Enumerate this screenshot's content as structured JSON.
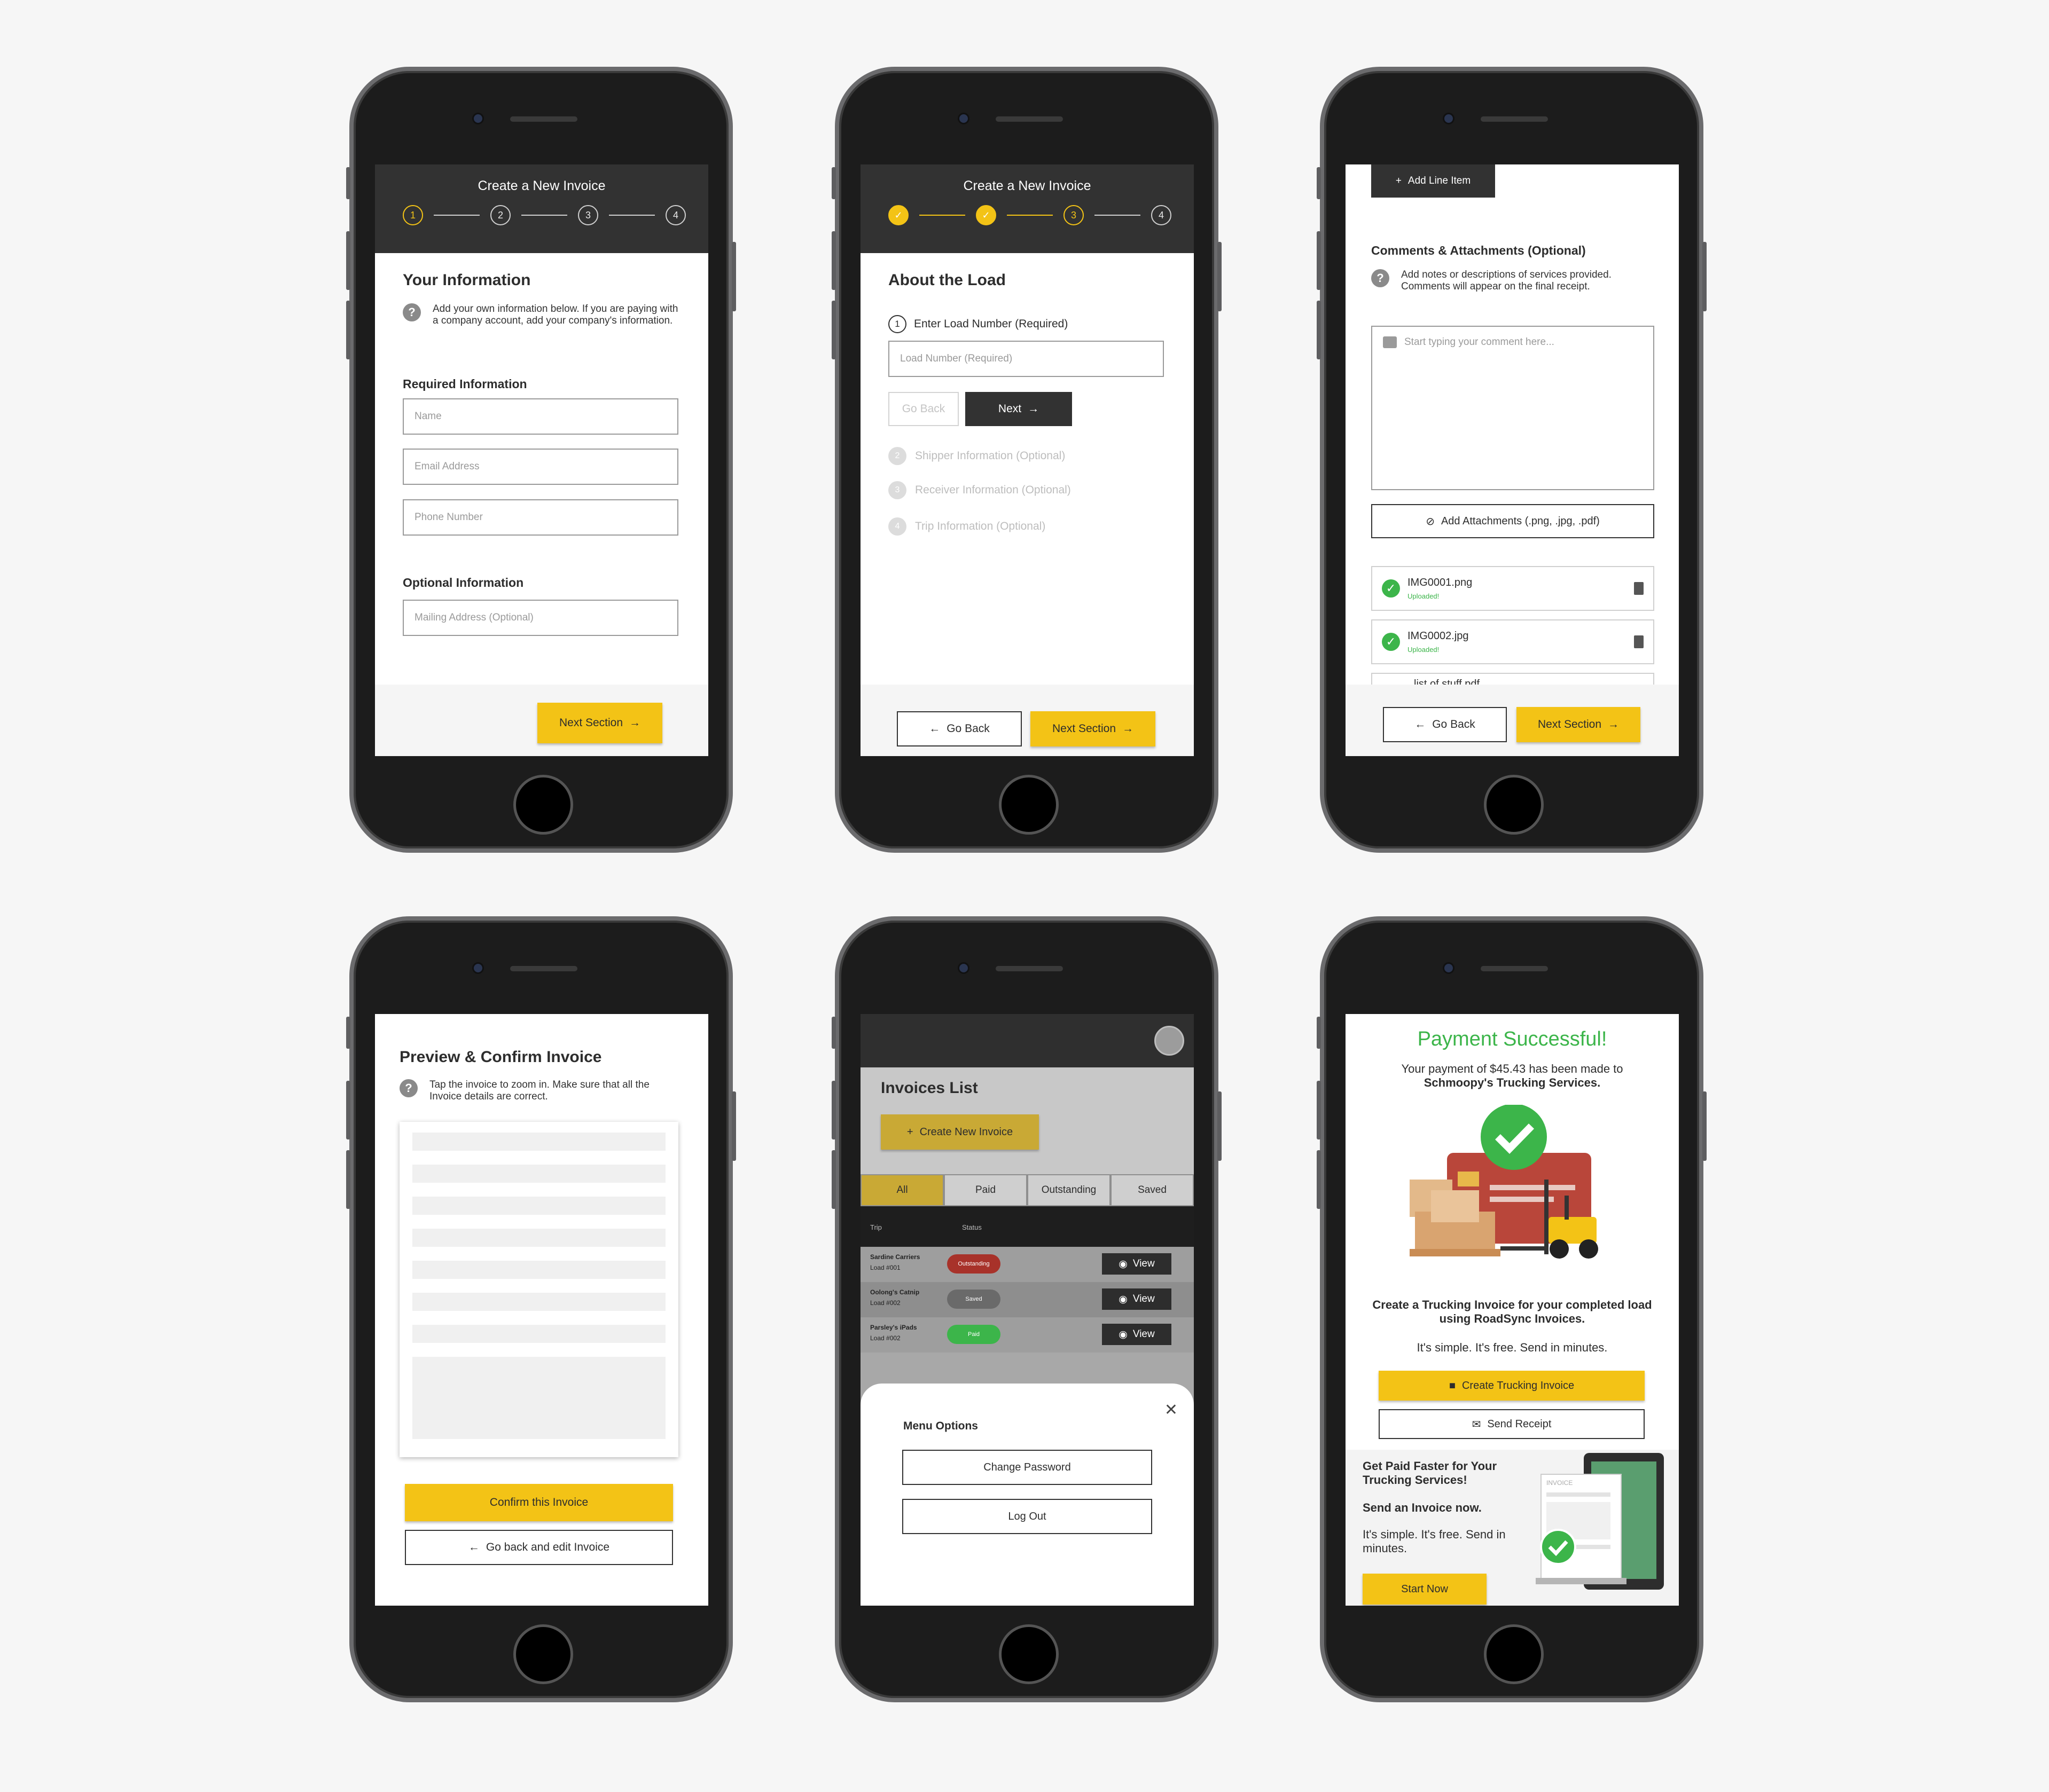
{
  "colors": {
    "accent": "#f3c316",
    "dark": "#323232",
    "success": "#3cb54a",
    "danger": "#c0392b"
  },
  "screen1": {
    "header_title": "Create a New Invoice",
    "steps": [
      "1",
      "2",
      "3",
      "4"
    ],
    "title": "Your Information",
    "help": "Add your own information below. If you are paying with a company account, add your company's information.",
    "required_label": "Required Information",
    "name_placeholder": "Name",
    "email_placeholder": "Email Address",
    "phone_placeholder": "Phone Number",
    "optional_label": "Optional Information",
    "mailing_placeholder": "Mailing Address (Optional)",
    "next_button": "Next Section"
  },
  "screen2": {
    "header_title": "Create a New Invoice",
    "steps": [
      "3",
      "4"
    ],
    "title": "About the Load",
    "step1_num": "1",
    "step1_label": "Enter Load Number (Required)",
    "load_placeholder": "Load Number (Required)",
    "goback_small": "Go Back",
    "next_small": "Next",
    "substeps": [
      {
        "num": "2",
        "label": "Shipper Information (Optional)"
      },
      {
        "num": "3",
        "label": "Receiver Information (Optional)"
      },
      {
        "num": "4",
        "label": "Trip Information (Optional)"
      }
    ],
    "goback_button": "Go Back",
    "next_button": "Next Section"
  },
  "screen3": {
    "add_line_item": "Add Line Item",
    "title": "Comments & Attachments (Optional)",
    "help": "Add notes or descriptions of services provided. Comments will appear on the final receipt.",
    "comment_placeholder": "Start typing your comment here...",
    "add_attachments": "Add Attachments (.png, .jpg, .pdf)",
    "files": [
      {
        "name": "IMG0001.png",
        "status": "Uploaded!"
      },
      {
        "name": "IMG0002.jpg",
        "status": "Uploaded!"
      }
    ],
    "partial_file": "list of stuff.pdf",
    "goback_button": "Go Back",
    "next_button": "Next Section"
  },
  "screen4": {
    "title": "Preview & Confirm Invoice",
    "help": "Tap the invoice to zoom in. Make sure that all the Invoice details are correct.",
    "confirm_button": "Confirm this Invoice",
    "goback_button": "Go back and edit Invoice"
  },
  "screen5": {
    "title": "Invoices List",
    "create_button": "Create New Invoice",
    "tabs": [
      "All",
      "Paid",
      "Outstanding",
      "Saved"
    ],
    "col_trip": "Trip",
    "col_status": "Status",
    "rows": [
      {
        "trip": "Sardine Carriers",
        "load": "Load #001",
        "status": "Outstanding",
        "view": "View"
      },
      {
        "trip": "Oolong's Catnip",
        "load": "Load #002",
        "status": "Saved",
        "view": "View"
      },
      {
        "trip": "Parsley's iPads",
        "load": "Load #002",
        "status": "Paid",
        "view": "View"
      }
    ],
    "menu_title": "Menu Options",
    "change_password": "Change Password",
    "log_out": "Log Out"
  },
  "screen6": {
    "title": "Payment Successful!",
    "message_line1": "Your payment of $45.43 has been made to",
    "message_line2": "Schmoopy's Trucking Services.",
    "promo_bold": "Create a Trucking Invoice for your completed load using RoadSync Invoices.",
    "promo_sub": "It's simple. It's free. Send in minutes.",
    "create_button": "Create Trucking Invoice",
    "receipt_button": "Send Receipt",
    "card_title": "Get Paid Faster for Your Trucking Services!",
    "card_sub": "Send an Invoice now.",
    "card_text": "It's simple. It's free. Send in minutes.",
    "invoice_word": "INVOICE",
    "start_button": "Start Now"
  }
}
